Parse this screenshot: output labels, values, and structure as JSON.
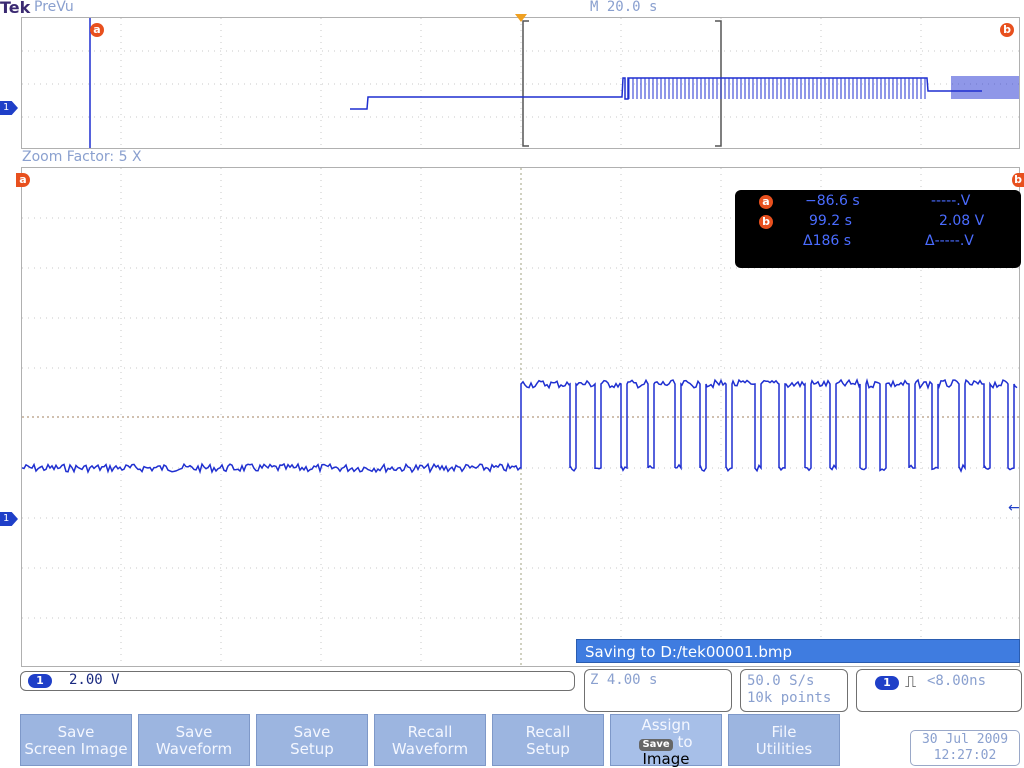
{
  "header": {
    "brand": "Tek",
    "mode": "PreVu",
    "main_scale": "M 20.0 s"
  },
  "preview": {
    "cursor_a_label": "a",
    "cursor_b_label": "b",
    "channel_marker": "1"
  },
  "zoom": {
    "factor_label": "Zoom Factor: 5 X",
    "cursor_a_label": "a",
    "cursor_b_label": "b",
    "channel_marker": "1"
  },
  "cursor_readout": {
    "a_label": "a",
    "a_time": "−86.6 s",
    "a_volts": "-----.V",
    "b_label": "b",
    "b_time": "99.2 s",
    "b_volts": "2.08 V",
    "delta_time": "Δ186 s",
    "delta_volts": "Δ-----.V"
  },
  "message": "Saving to D:/tek00001.bmp",
  "status": {
    "ch1_badge": "1",
    "ch1_scale": "2.00 V",
    "zoom_scale": "Z 4.00 s",
    "sample_rate": "50.0 S/s",
    "record_length": "10k points",
    "trig_badge": "1",
    "trig_symbol": "⎍",
    "trig_value": "<8.00ns"
  },
  "softkeys": [
    {
      "line1": "Save",
      "line2": "Screen Image"
    },
    {
      "line1": "Save",
      "line2": "Waveform"
    },
    {
      "line1": "Save",
      "line2": "Setup"
    },
    {
      "line1": "Recall",
      "line2": "Waveform"
    },
    {
      "line1": "Recall",
      "line2": "Setup"
    },
    {
      "line1": "Assign",
      "badge": "Save",
      "line2": "to",
      "line3": "Image"
    },
    {
      "line1": "File",
      "line2": "Utilities"
    }
  ],
  "datetime": {
    "date": "30 Jul  2009",
    "time": "12:27:02"
  },
  "colors": {
    "trace": "#1f2fd0",
    "cursor_badge": "#e8501e",
    "message_bg": "#3f7ce0",
    "softkey_bg": "#9cb5e0",
    "label_text": "#8aa0cf"
  }
}
